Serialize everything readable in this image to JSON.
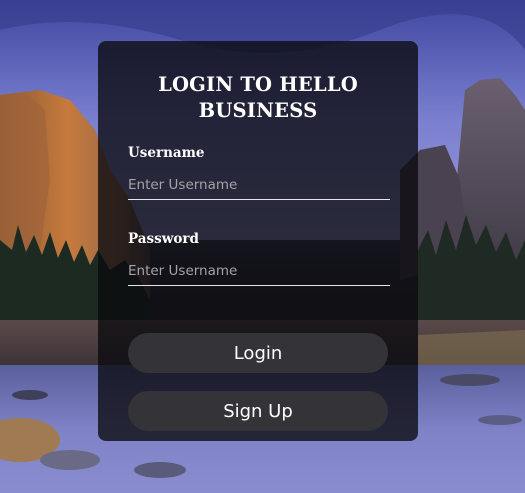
{
  "form": {
    "title": "LOGIN TO HELLO BUSINESS",
    "username_label": "Username",
    "username_placeholder": "Enter Username",
    "password_label": "Password",
    "password_placeholder": "Enter Username",
    "login_label": "Login",
    "signup_label": "Sign Up"
  },
  "colors": {
    "card_background": "#0a0a0e",
    "button_background": "#333338",
    "text": "#ffffff",
    "placeholder": "#a3a3a8",
    "underline": "#e6e6e6"
  }
}
